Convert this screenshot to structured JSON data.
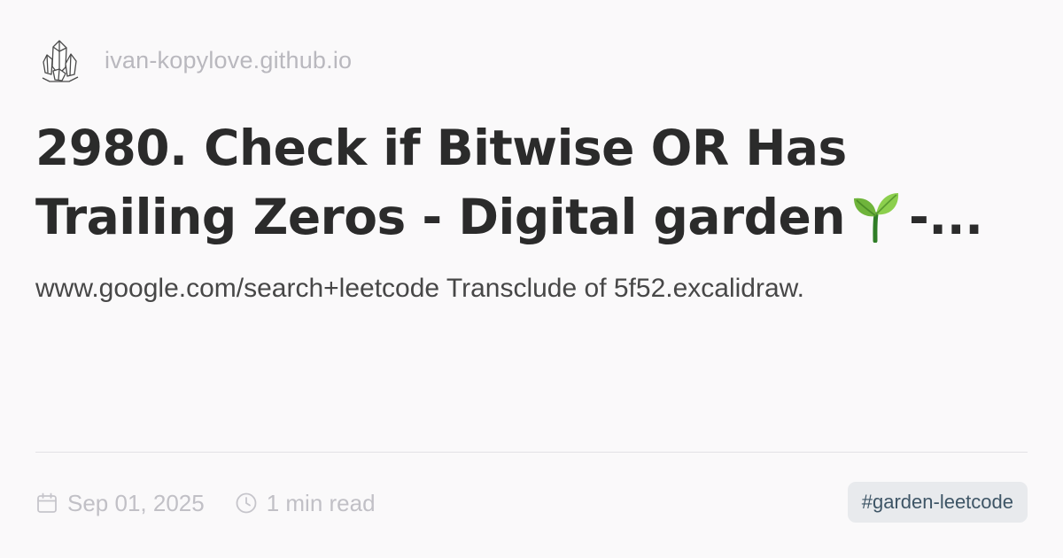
{
  "site": {
    "logo_icon": "crystal-cluster-icon",
    "domain": "ivan-kopylove.github.io"
  },
  "article": {
    "title_line1": "2980. Check if Bitwise OR Has",
    "title_line2_prefix": "Trailing Zeros - Digital garden",
    "title_emoji_icon": "seedling-icon",
    "title_line2_suffix": "-...",
    "description": "www.google.com/search+leetcode Transclude of 5f52.excalidraw."
  },
  "meta": {
    "date_icon": "calendar-icon",
    "date": "Sep 01, 2025",
    "reading_icon": "clock-icon",
    "reading_time": "1 min read"
  },
  "tags": [
    {
      "label": "#garden-leetcode"
    }
  ],
  "colors": {
    "background": "#faf9fa",
    "title": "#2b2b2b",
    "description": "#474747",
    "muted": "#c1c0c6",
    "tag_bg": "#e8eaed",
    "tag_text": "#3e5566"
  }
}
